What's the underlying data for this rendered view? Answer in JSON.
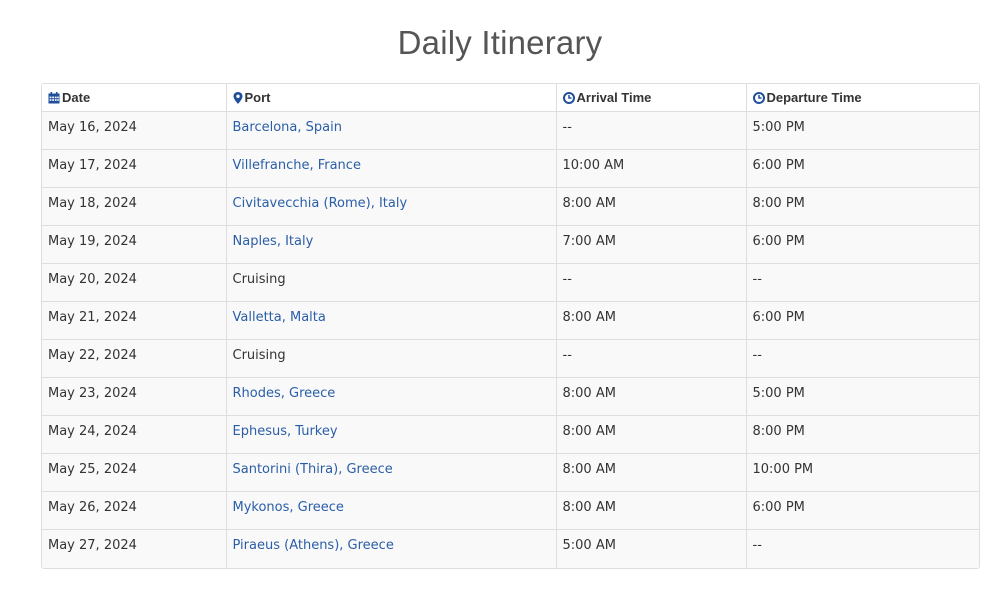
{
  "page": {
    "title": "Daily Itinerary"
  },
  "colors": {
    "link": "#2a5ea8",
    "icon": "#1f4f9a",
    "border": "#dedede"
  },
  "columns": [
    {
      "label": "Date",
      "icon": "calendar-icon"
    },
    {
      "label": "Port",
      "icon": "map-pin-icon"
    },
    {
      "label": "Arrival Time",
      "icon": "clock-icon"
    },
    {
      "label": "Departure Time",
      "icon": "clock-icon"
    }
  ],
  "rows": [
    {
      "date": "May 16, 2024",
      "port": "Barcelona, Spain",
      "port_is_link": true,
      "arrival": "--",
      "departure": "5:00 PM"
    },
    {
      "date": "May 17, 2024",
      "port": "Villefranche, France",
      "port_is_link": true,
      "arrival": "10:00 AM",
      "departure": "6:00 PM"
    },
    {
      "date": "May 18, 2024",
      "port": "Civitavecchia (Rome), Italy",
      "port_is_link": true,
      "arrival": "8:00 AM",
      "departure": "8:00 PM"
    },
    {
      "date": "May 19, 2024",
      "port": "Naples, Italy",
      "port_is_link": true,
      "arrival": "7:00 AM",
      "departure": "6:00 PM"
    },
    {
      "date": "May 20, 2024",
      "port": "Cruising",
      "port_is_link": false,
      "arrival": "--",
      "departure": "--"
    },
    {
      "date": "May 21, 2024",
      "port": "Valletta, Malta",
      "port_is_link": true,
      "arrival": "8:00 AM",
      "departure": "6:00 PM"
    },
    {
      "date": "May 22, 2024",
      "port": "Cruising",
      "port_is_link": false,
      "arrival": "--",
      "departure": "--"
    },
    {
      "date": "May 23, 2024",
      "port": "Rhodes, Greece",
      "port_is_link": true,
      "arrival": "8:00 AM",
      "departure": "5:00 PM"
    },
    {
      "date": "May 24, 2024",
      "port": "Ephesus, Turkey",
      "port_is_link": true,
      "arrival": "8:00 AM",
      "departure": "8:00 PM"
    },
    {
      "date": "May 25, 2024",
      "port": "Santorini (Thira), Greece",
      "port_is_link": true,
      "arrival": "8:00 AM",
      "departure": "10:00 PM"
    },
    {
      "date": "May 26, 2024",
      "port": "Mykonos, Greece",
      "port_is_link": true,
      "arrival": "8:00 AM",
      "departure": "6:00 PM"
    },
    {
      "date": "May 27, 2024",
      "port": "Piraeus (Athens), Greece",
      "port_is_link": true,
      "arrival": "5:00 AM",
      "departure": "--"
    }
  ]
}
